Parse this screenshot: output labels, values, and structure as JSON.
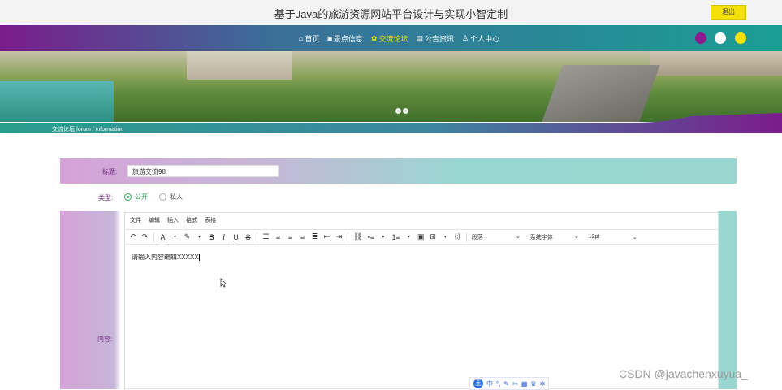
{
  "header": {
    "title": "基于Java的旅游资源网站平台设计与实现小智定制",
    "logout_label": "退出"
  },
  "nav": {
    "items": [
      {
        "label": "首页",
        "icon": "home-icon",
        "active": false
      },
      {
        "label": "景点信息",
        "icon": "camera-icon",
        "active": false
      },
      {
        "label": "交流论坛",
        "icon": "flower-icon",
        "active": true
      },
      {
        "label": "公告资讯",
        "icon": "document-icon",
        "active": false
      },
      {
        "label": "个人中心",
        "icon": "user-icon",
        "active": false
      }
    ],
    "theme_dots": [
      "#8a1c8e",
      "#ffffff",
      "#f5e10a"
    ]
  },
  "breadcrumb": {
    "text": "交流论坛   forum / information"
  },
  "form": {
    "title_label": "标题:",
    "title_value": "旅游交流98",
    "type_label": "类型:",
    "type_options": [
      {
        "label": "公开",
        "selected": true
      },
      {
        "label": "私人",
        "selected": false
      }
    ],
    "content_label": "内容:"
  },
  "editor": {
    "menu": [
      "文件",
      "编辑",
      "插入",
      "格式",
      "表格"
    ],
    "paragraph_select": "段落",
    "font_select": "系统字体",
    "size_select": "12pt",
    "content": "请输入内容编辑XXXXX"
  },
  "ime": {
    "logo": "王",
    "mode": "中"
  },
  "watermark": "CSDN @javachenxuyua_"
}
